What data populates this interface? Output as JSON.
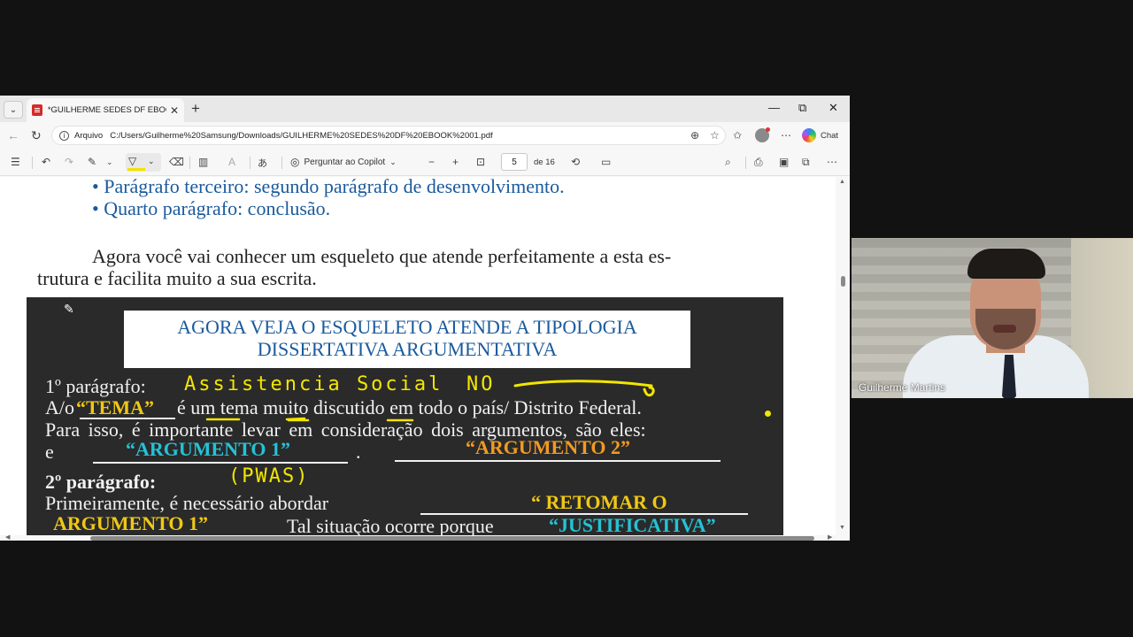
{
  "browser": {
    "tab_title": "*GUILHERME SEDES DF EBOOK 01",
    "address_label": "Arquivo",
    "url": "C:/Users/Guilherme%20Samsung/Downloads/GUILHERME%20SEDES%20DF%20EBOOK%2001.pdf",
    "chat_label": "Chat"
  },
  "pdf_toolbar": {
    "ask_copilot_label": "Perguntar ao Copilot",
    "current_page": "5",
    "page_total": "de 16"
  },
  "document": {
    "bullet_3": "• Parágrafo terceiro: segundo parágrafo de desenvolvimento.",
    "bullet_4": "• Quarto parágrafo: conclusão.",
    "intro_line_1": "Agora você vai conhecer um esqueleto que atende perfeitamente a esta es-",
    "intro_line_2": "trutura e facilita muito a sua escrita.",
    "box_title_1": "AGORA VEJA O ESQUELETO ATENDE A TIPOLOGIA",
    "box_title_2": "DISSERTATIVA ARGUMENTATIVA",
    "p1_label": "1º parágrafo:",
    "p1_line1_prefix": "A/o",
    "tema": "“TEMA”",
    "p1_line1_suffix": "é um tema muito discutido em todo o país/ Distrito Federal.",
    "p1_line2": "Para isso, é importante levar em consideração dois argumentos, são eles:",
    "p1_line3_prefix": "e",
    "argumento_1": "“ARGUMENTO 1”",
    "argumento_2": "“ARGUMENTO 2”",
    "p2_label": "2º parágrafo:",
    "p2_line1": "Primeiramente, é necessário abordar",
    "retomar": "“ RETOMAR O",
    "argumento_1_cont": "ARGUMENTO 1”",
    "p2_line2_mid": "Tal situação ocorre porque",
    "justificativa": "“JUSTIFICATIVA”"
  },
  "annotations": {
    "note_1": "Assistencia Social",
    "note_2": "NO",
    "note_3": "(PWAS)"
  },
  "webcam": {
    "name": "Guilherme Martins"
  },
  "colors": {
    "bullet_blue": "#1a5a9c",
    "dark_box": "#2a2a2a",
    "yellow": "#f0c814",
    "cyan": "#25c2d6",
    "orange": "#f19a24",
    "handwriting": "#f3e600"
  }
}
